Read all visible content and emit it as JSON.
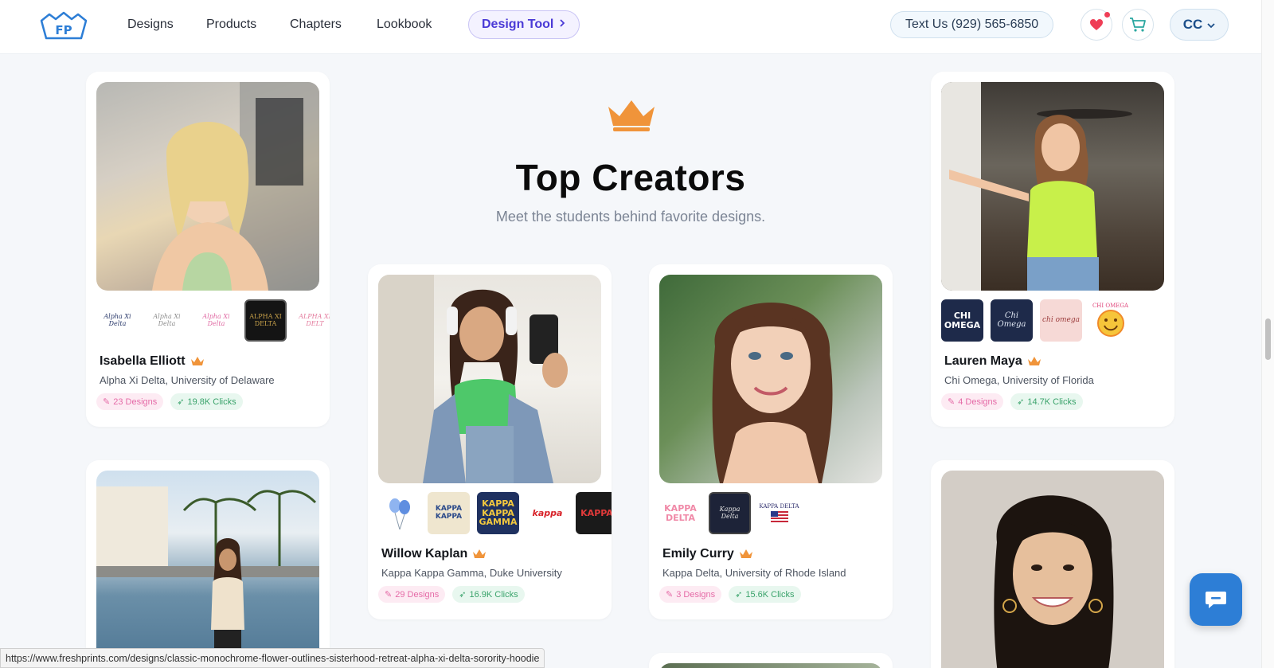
{
  "nav": {
    "links": [
      "Designs",
      "Products",
      "Chapters",
      "Lookbook"
    ],
    "design_tool_label": "Design Tool",
    "text_us_label": "Text Us (929) 565-6850",
    "account_initials": "CC",
    "logo_icon": "fresh-prints-logo-icon",
    "favorites_icon": "heart-icon",
    "cart_icon": "cart-icon"
  },
  "section": {
    "title": "Top Creators",
    "subtitle": "Meet the students behind favorite designs.",
    "icon": "crown-icon"
  },
  "creators": [
    {
      "name": "Isabella Elliott",
      "affiliation": "Alpha Xi Delta, University of Delaware",
      "designs": "23 Designs",
      "clicks": "19.8K Clicks",
      "thumbs": [
        "Alpha Xi Delta",
        "Alpha Xi Delta",
        "Alpha Xi Delta",
        "ALPHA XI DELTA",
        "ALPHA XI DELT"
      ]
    },
    {
      "name": "Lauren Maya",
      "affiliation": "Chi Omega, University of Florida",
      "designs": "4 Designs",
      "clicks": "14.7K Clicks",
      "thumbs": [
        "CHI OMEGA",
        "Chi Omega",
        "chi omega",
        "CHI OMEGA"
      ]
    },
    {
      "name": "Willow Kaplan",
      "affiliation": "Kappa Kappa Gamma, Duke University",
      "designs": "29 Designs",
      "clicks": "16.9K Clicks",
      "thumbs": [
        "",
        "KAPPA KAPPA",
        "KAPPA KAPPA GAMMA",
        "kappa",
        "KAPPA"
      ]
    },
    {
      "name": "Emily Curry",
      "affiliation": "Kappa Delta, University of Rhode Island",
      "designs": "3 Designs",
      "clicks": "15.6K Clicks",
      "thumbs": [
        "KAPPA DELTA",
        "Kappa Delta",
        "KAPPA DELTA"
      ]
    }
  ],
  "status_url": "https://www.freshprints.com/designs/classic-monochrome-flower-outlines-sisterhood-retreat-alpha-xi-delta-sorority-hoodie",
  "chat_icon": "chat-bubble-icon",
  "colors": {
    "accent": "#4a3ad6",
    "crown": "#f0943a",
    "chat": "#2d7ed6",
    "designs_badge": "#e56ba7",
    "clicks_badge": "#3aa36b"
  }
}
